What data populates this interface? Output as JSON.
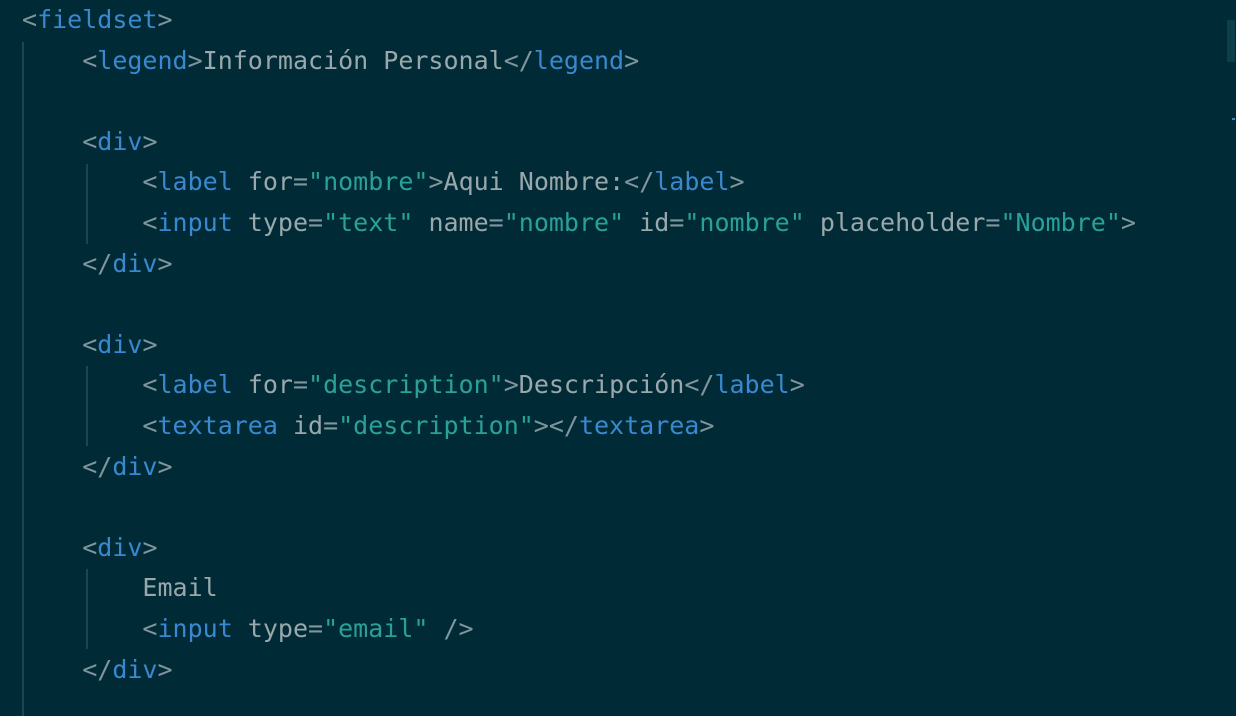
{
  "lines": [
    {
      "tokens": [
        {
          "t": "<",
          "c": "tok-p"
        },
        {
          "t": "fieldset",
          "c": "tok-tag"
        },
        {
          "t": ">",
          "c": "tok-p"
        }
      ]
    },
    {
      "tokens": [
        {
          "t": "    ",
          "c": "tok-txt"
        },
        {
          "t": "<",
          "c": "tok-p"
        },
        {
          "t": "legend",
          "c": "tok-tag"
        },
        {
          "t": ">",
          "c": "tok-p"
        },
        {
          "t": "Información Personal",
          "c": "tok-txt"
        },
        {
          "t": "</",
          "c": "tok-p"
        },
        {
          "t": "legend",
          "c": "tok-tag"
        },
        {
          "t": ">",
          "c": "tok-p"
        }
      ]
    },
    {
      "tokens": []
    },
    {
      "tokens": [
        {
          "t": "    ",
          "c": "tok-txt"
        },
        {
          "t": "<",
          "c": "tok-p"
        },
        {
          "t": "div",
          "c": "tok-tag"
        },
        {
          "t": ">",
          "c": "tok-p"
        }
      ]
    },
    {
      "tokens": [
        {
          "t": "        ",
          "c": "tok-txt"
        },
        {
          "t": "<",
          "c": "tok-p"
        },
        {
          "t": "label",
          "c": "tok-tag"
        },
        {
          "t": " for",
          "c": "tok-attr"
        },
        {
          "t": "=",
          "c": "tok-p"
        },
        {
          "t": "\"nombre\"",
          "c": "tok-str"
        },
        {
          "t": ">",
          "c": "tok-p"
        },
        {
          "t": "Aqui Nombre:",
          "c": "tok-txt"
        },
        {
          "t": "</",
          "c": "tok-p"
        },
        {
          "t": "label",
          "c": "tok-tag"
        },
        {
          "t": ">",
          "c": "tok-p"
        }
      ]
    },
    {
      "tokens": [
        {
          "t": "        ",
          "c": "tok-txt"
        },
        {
          "t": "<",
          "c": "tok-p"
        },
        {
          "t": "input",
          "c": "tok-tag"
        },
        {
          "t": " type",
          "c": "tok-attr"
        },
        {
          "t": "=",
          "c": "tok-p"
        },
        {
          "t": "\"text\"",
          "c": "tok-str"
        },
        {
          "t": " name",
          "c": "tok-attr"
        },
        {
          "t": "=",
          "c": "tok-p"
        },
        {
          "t": "\"nombre\"",
          "c": "tok-str"
        },
        {
          "t": " id",
          "c": "tok-attr"
        },
        {
          "t": "=",
          "c": "tok-p"
        },
        {
          "t": "\"nombre\"",
          "c": "tok-str"
        },
        {
          "t": " placeholder",
          "c": "tok-attr"
        },
        {
          "t": "=",
          "c": "tok-p"
        },
        {
          "t": "\"Nombre\"",
          "c": "tok-str"
        },
        {
          "t": ">",
          "c": "tok-p"
        }
      ]
    },
    {
      "tokens": [
        {
          "t": "    ",
          "c": "tok-txt"
        },
        {
          "t": "</",
          "c": "tok-p"
        },
        {
          "t": "div",
          "c": "tok-tag"
        },
        {
          "t": ">",
          "c": "tok-p"
        }
      ]
    },
    {
      "tokens": []
    },
    {
      "tokens": [
        {
          "t": "    ",
          "c": "tok-txt"
        },
        {
          "t": "<",
          "c": "tok-p"
        },
        {
          "t": "div",
          "c": "tok-tag"
        },
        {
          "t": ">",
          "c": "tok-p"
        }
      ]
    },
    {
      "tokens": [
        {
          "t": "        ",
          "c": "tok-txt"
        },
        {
          "t": "<",
          "c": "tok-p"
        },
        {
          "t": "label",
          "c": "tok-tag"
        },
        {
          "t": " for",
          "c": "tok-attr"
        },
        {
          "t": "=",
          "c": "tok-p"
        },
        {
          "t": "\"description\"",
          "c": "tok-str"
        },
        {
          "t": ">",
          "c": "tok-p"
        },
        {
          "t": "Descripción",
          "c": "tok-txt"
        },
        {
          "t": "</",
          "c": "tok-p"
        },
        {
          "t": "label",
          "c": "tok-tag"
        },
        {
          "t": ">",
          "c": "tok-p"
        }
      ]
    },
    {
      "tokens": [
        {
          "t": "        ",
          "c": "tok-txt"
        },
        {
          "t": "<",
          "c": "tok-p"
        },
        {
          "t": "textarea",
          "c": "tok-tag"
        },
        {
          "t": " id",
          "c": "tok-attr"
        },
        {
          "t": "=",
          "c": "tok-p"
        },
        {
          "t": "\"description\"",
          "c": "tok-str"
        },
        {
          "t": "></",
          "c": "tok-p"
        },
        {
          "t": "textarea",
          "c": "tok-tag"
        },
        {
          "t": ">",
          "c": "tok-p"
        }
      ]
    },
    {
      "tokens": [
        {
          "t": "    ",
          "c": "tok-txt"
        },
        {
          "t": "</",
          "c": "tok-p"
        },
        {
          "t": "div",
          "c": "tok-tag"
        },
        {
          "t": ">",
          "c": "tok-p"
        }
      ]
    },
    {
      "tokens": []
    },
    {
      "tokens": [
        {
          "t": "    ",
          "c": "tok-txt"
        },
        {
          "t": "<",
          "c": "tok-p"
        },
        {
          "t": "div",
          "c": "tok-tag"
        },
        {
          "t": ">",
          "c": "tok-p"
        }
      ]
    },
    {
      "tokens": [
        {
          "t": "        ",
          "c": "tok-txt"
        },
        {
          "t": "Email",
          "c": "tok-txt"
        }
      ]
    },
    {
      "tokens": [
        {
          "t": "        ",
          "c": "tok-txt"
        },
        {
          "t": "<",
          "c": "tok-p"
        },
        {
          "t": "input",
          "c": "tok-tag"
        },
        {
          "t": " type",
          "c": "tok-attr"
        },
        {
          "t": "=",
          "c": "tok-p"
        },
        {
          "t": "\"email\"",
          "c": "tok-str"
        },
        {
          "t": " />",
          "c": "tok-p"
        }
      ]
    },
    {
      "tokens": [
        {
          "t": "    ",
          "c": "tok-txt"
        },
        {
          "t": "</",
          "c": "tok-p"
        },
        {
          "t": "div",
          "c": "tok-tag"
        },
        {
          "t": ">",
          "c": "tok-p"
        }
      ]
    }
  ],
  "colors": {
    "background": "#002b36",
    "tag": "#3a88cf",
    "punctuation": "#80959c",
    "string": "#2aa198",
    "attribute": "#9aa8ab",
    "text": "#9aa8ab"
  }
}
